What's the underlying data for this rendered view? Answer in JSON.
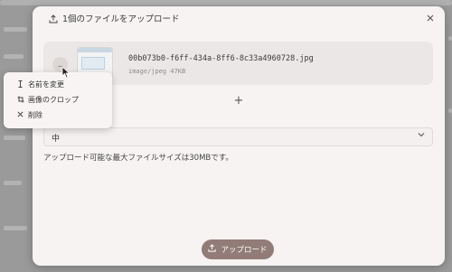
{
  "modal": {
    "title": "1個のファイルをアップロード",
    "close_icon": "close-icon",
    "upload_icon": "upload-icon"
  },
  "file": {
    "name": "00b073b0-f6ff-434a-8ff6-8c33a4960728.jpg",
    "meta": "image/jpeg 47KB",
    "more_label": "..."
  },
  "add_button": "+",
  "select": {
    "value": "中"
  },
  "hint": "アップロード可能な最大ファイルサイズは30MBです。",
  "upload_button": {
    "label": "アップロード"
  },
  "menu": {
    "items": [
      {
        "icon": "text-cursor-icon",
        "label": "名前を変更"
      },
      {
        "icon": "crop-icon",
        "label": "画像のクロップ"
      },
      {
        "icon": "close-icon",
        "label": "削除"
      }
    ]
  },
  "colors": {
    "accent": "#927c77",
    "modal_bg": "#f6f3f2",
    "card_bg": "#ebe7e6"
  }
}
